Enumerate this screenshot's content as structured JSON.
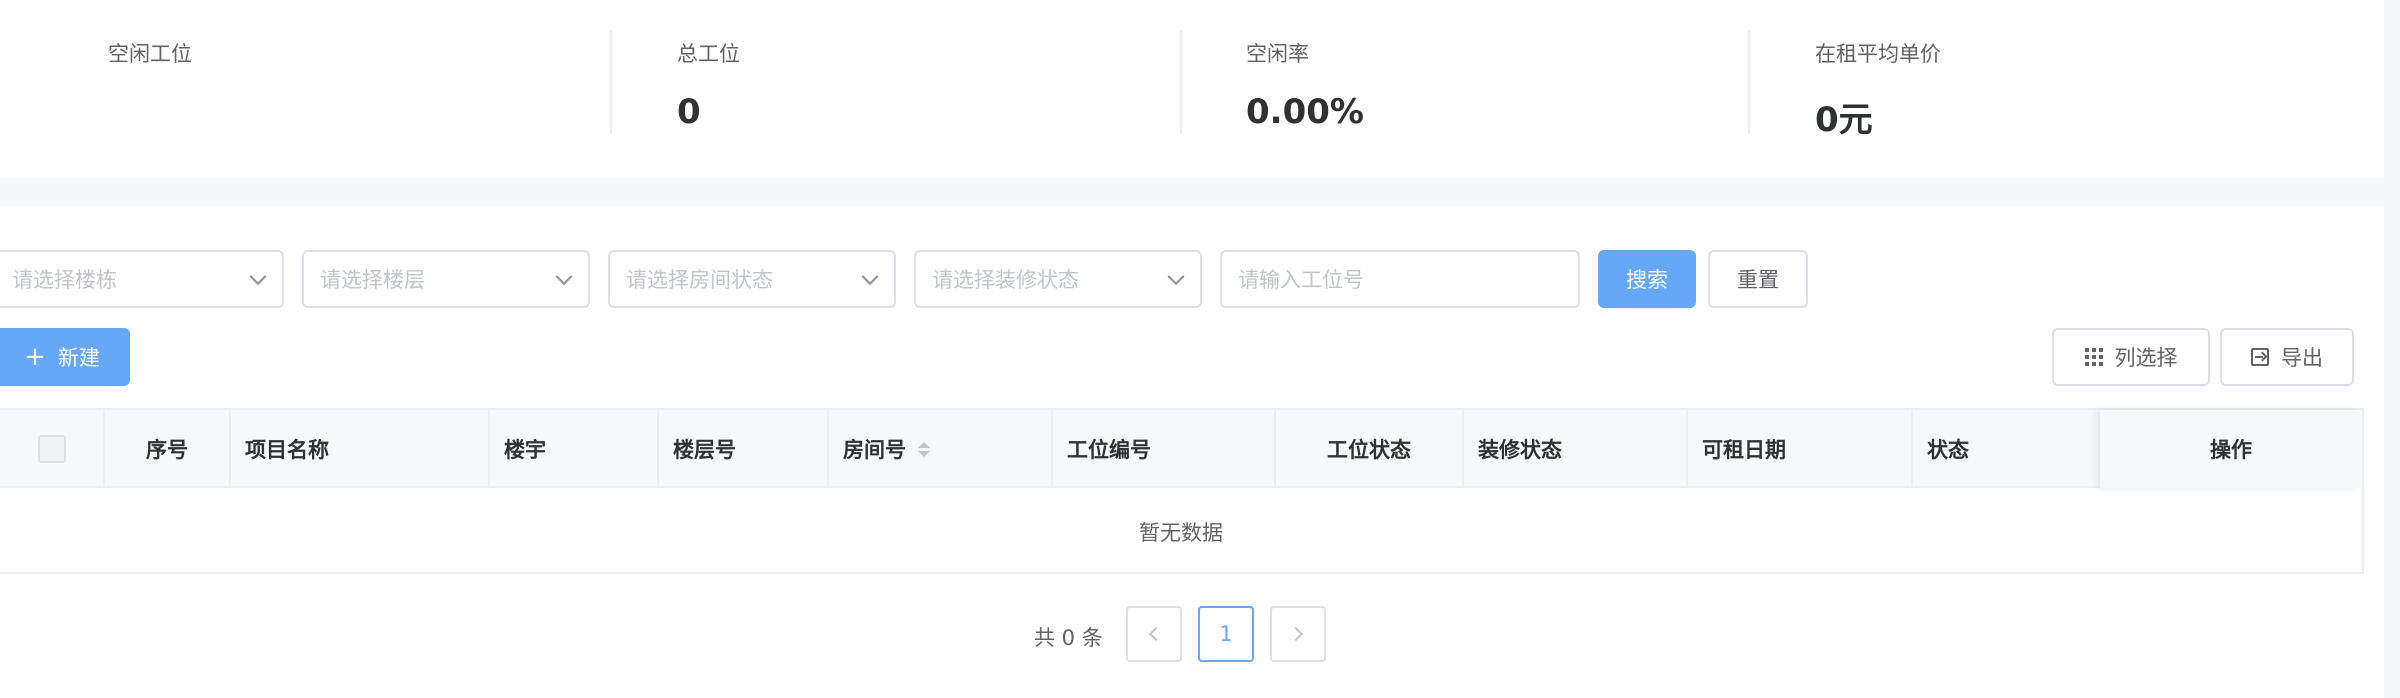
{
  "stats": [
    {
      "label": "空闲工位",
      "value": ""
    },
    {
      "label": "总工位",
      "value": "0"
    },
    {
      "label": "空闲率",
      "value": "0.00%"
    },
    {
      "label": "在租平均单价",
      "value": "0元"
    }
  ],
  "filters": {
    "building_placeholder": "请选择楼栋",
    "floor_placeholder": "请选择楼层",
    "room_status_placeholder": "请选择房间状态",
    "decoration_status_placeholder": "请选择装修状态",
    "seat_no_placeholder": "请输入工位号",
    "search_label": "搜索",
    "reset_label": "重置"
  },
  "toolbar": {
    "new_label": "新建",
    "column_select_label": "列选择",
    "export_label": "导出"
  },
  "table": {
    "columns": [
      "序号",
      "项目名称",
      "楼宇",
      "楼层号",
      "房间号",
      "工位编号",
      "工位状态",
      "装修状态",
      "可租日期",
      "状态"
    ],
    "ops_column": "操作",
    "empty_text": "暂无数据"
  },
  "pagination": {
    "total_text": "共 0 条",
    "current_page": "1"
  },
  "colors": {
    "primary": "#66a8f8",
    "border": "#dcdfe6",
    "background": "#f5f7fa"
  }
}
